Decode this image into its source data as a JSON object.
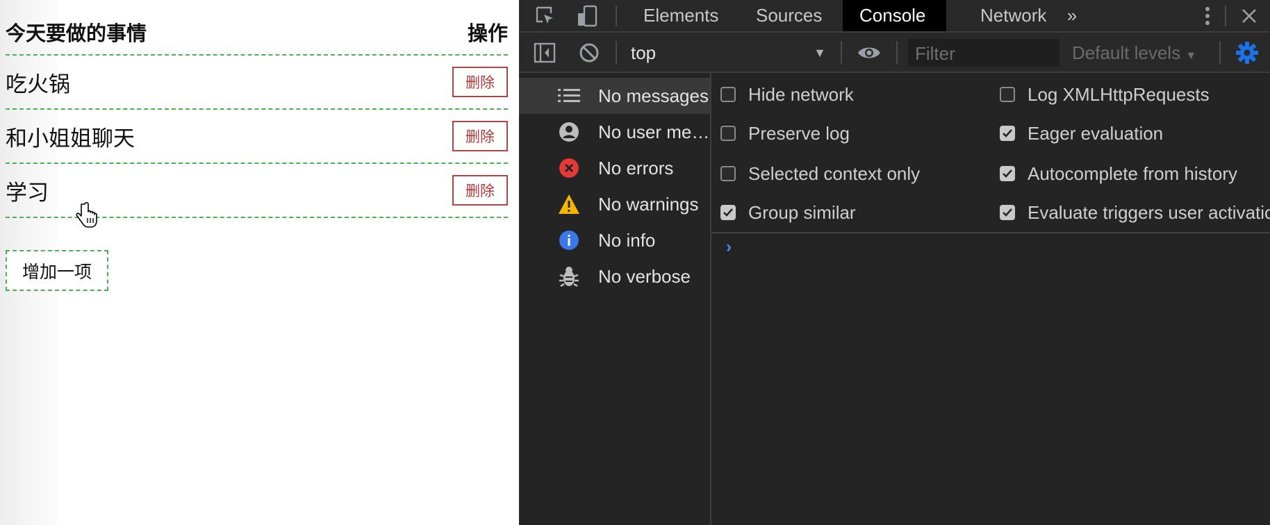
{
  "page": {
    "header": {
      "title": "今天要做的事情",
      "action": "操作"
    },
    "items": [
      {
        "text": "吃火锅",
        "delete_label": "删除"
      },
      {
        "text": "和小姐姐聊天",
        "delete_label": "删除"
      },
      {
        "text": "学习",
        "delete_label": "删除"
      }
    ],
    "add_label": "增加一项"
  },
  "devtools": {
    "tabs": [
      "Elements",
      "Sources",
      "Console",
      "Network"
    ],
    "active_tab": "Console",
    "toolbar": {
      "context": "top",
      "filter_placeholder": "Filter",
      "levels": "Default levels"
    },
    "sidebar": [
      {
        "label": "No messages",
        "icon": "list-icon"
      },
      {
        "label": "No user me…",
        "icon": "user-icon"
      },
      {
        "label": "No errors",
        "icon": "error-icon"
      },
      {
        "label": "No warnings",
        "icon": "warning-icon"
      },
      {
        "label": "No info",
        "icon": "info-icon"
      },
      {
        "label": "No verbose",
        "icon": "bug-icon"
      }
    ],
    "settings_left": [
      {
        "label": "Hide network",
        "checked": false
      },
      {
        "label": "Preserve log",
        "checked": false
      },
      {
        "label": "Selected context only",
        "checked": false
      },
      {
        "label": "Group similar",
        "checked": true
      }
    ],
    "settings_right": [
      {
        "label": "Log XMLHttpRequests",
        "checked": false
      },
      {
        "label": "Eager evaluation",
        "checked": true
      },
      {
        "label": "Autocomplete from history",
        "checked": true
      },
      {
        "label": "Evaluate triggers user activation",
        "checked": true
      }
    ],
    "prompt": "›"
  },
  "colors": {
    "accent_dashed": "#4caf50",
    "delete": "#b03a3a",
    "error": "#e53935",
    "warning": "#f5b400",
    "info": "#3b78e7",
    "gear": "#1a73e8"
  }
}
